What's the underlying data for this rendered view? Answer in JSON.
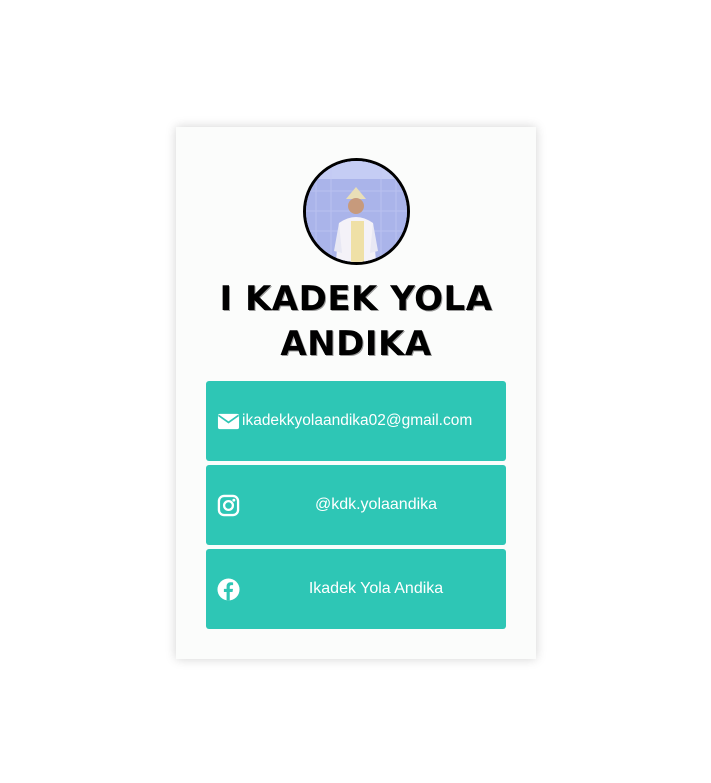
{
  "profile": {
    "name": "I KADEK YOLA ANDIKA",
    "avatar_icon": "profile-photo"
  },
  "links": {
    "email": {
      "label": "ikadekkyolaandika02@gmail.com",
      "icon": "envelope-icon"
    },
    "instagram": {
      "label": "@kdk.yolaandika",
      "icon": "instagram-icon"
    },
    "facebook": {
      "label": "Ikadek Yola Andika",
      "icon": "facebook-icon"
    }
  },
  "colors": {
    "accent": "#2ec6b5",
    "card": "#fbfcfb",
    "text_on_accent": "#ffffff"
  }
}
